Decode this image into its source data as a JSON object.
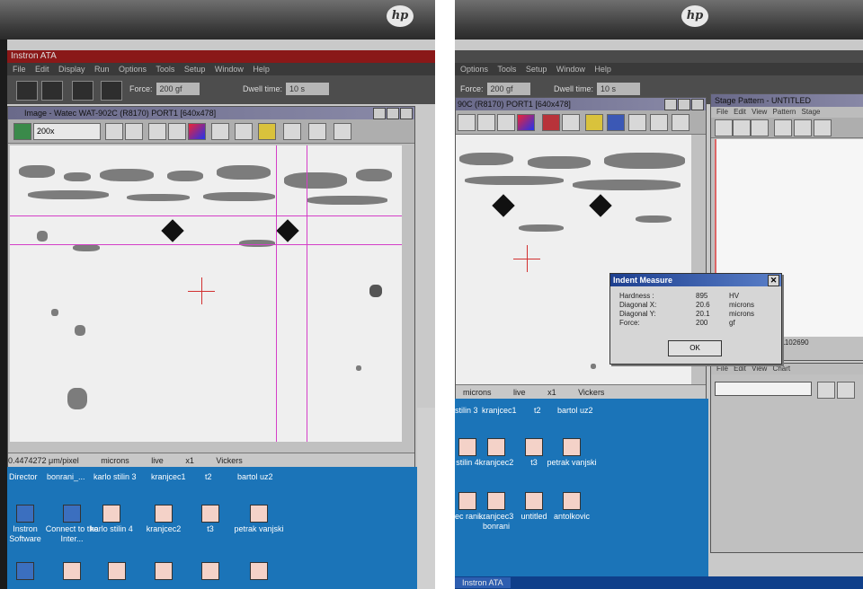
{
  "left": {
    "brand": "hp",
    "app_title": "Instron ATA",
    "menu": "File  Edit  Display  Run  Options  Tools  Setup  Window  Help",
    "force_label": "Force:",
    "force_value": "200 gf",
    "dwell_label": "Dwell time:",
    "dwell_value": "10 s",
    "image_window_title": "Image - Watec WAT-902C (R8170) PORT1 [640x478]",
    "zoom_value": "200x",
    "status": {
      "scale": "0.4474272 μm/pixel",
      "units": "microns",
      "live": "live",
      "zoom": "x1",
      "method": "Vickers"
    },
    "desktop_row1": [
      "Director",
      "bonrani_...",
      "karlo stilin 3",
      "kranjcec1",
      "t2",
      "bartol uz2"
    ],
    "desktop_icons": [
      {
        "label": "Instron Software",
        "style": "blue"
      },
      {
        "label": "Connect to the Inter...",
        "style": "blue"
      },
      {
        "label": "karlo stilin 4",
        "style": "red"
      },
      {
        "label": "kranjcec2",
        "style": "red"
      },
      {
        "label": "t3",
        "style": "red"
      },
      {
        "label": "petrak vanjski",
        "style": "red"
      }
    ]
  },
  "right": {
    "brand": "hp",
    "menu": "Options  Tools  Setup  Window  Help",
    "force_label": "Force:",
    "force_value": "200 gf",
    "dwell_label": "Dwell time:",
    "dwell_value": "10 s",
    "image_window_title": "90C (R8170) PORT1 [640x478]",
    "stage_window_title": "Stage Pattern - UNTITLED",
    "stage_menu": "File  Edit  View  Pattern  Stage",
    "stage_readout": "1102690",
    "chart_menu": "File  Edit  View  Chart",
    "status": {
      "units": "microns",
      "live": "live",
      "zoom": "x1",
      "method": "Vickers"
    },
    "dialog": {
      "title": "Indent Measure",
      "rows": [
        {
          "key": "Hardness :",
          "value": "895",
          "unit": "HV"
        },
        {
          "key": "Diagonal X:",
          "value": "20.6",
          "unit": "microns"
        },
        {
          "key": "Diagonal Y:",
          "value": "20.1",
          "unit": "microns"
        },
        {
          "key": "Force:",
          "value": "200",
          "unit": "gf"
        }
      ],
      "ok": "OK"
    },
    "desktop_row1": [
      "stilin 3",
      "kranjcec1",
      "t2",
      "bartol uz2"
    ],
    "desktop_icons_row2": [
      {
        "label": "stilin 4",
        "style": "red"
      },
      {
        "label": "kranjcec2",
        "style": "red"
      },
      {
        "label": "t3",
        "style": "red"
      },
      {
        "label": "petrak vanjski",
        "style": "red"
      }
    ],
    "desktop_icons_row3": [
      {
        "label": "jcec rani...",
        "style": "red"
      },
      {
        "label": "kranjcec3 bonrani",
        "style": "red"
      },
      {
        "label": "untitled",
        "style": "red"
      },
      {
        "label": "antolkovic",
        "style": "red"
      }
    ],
    "taskbar": "Instron ATA"
  }
}
